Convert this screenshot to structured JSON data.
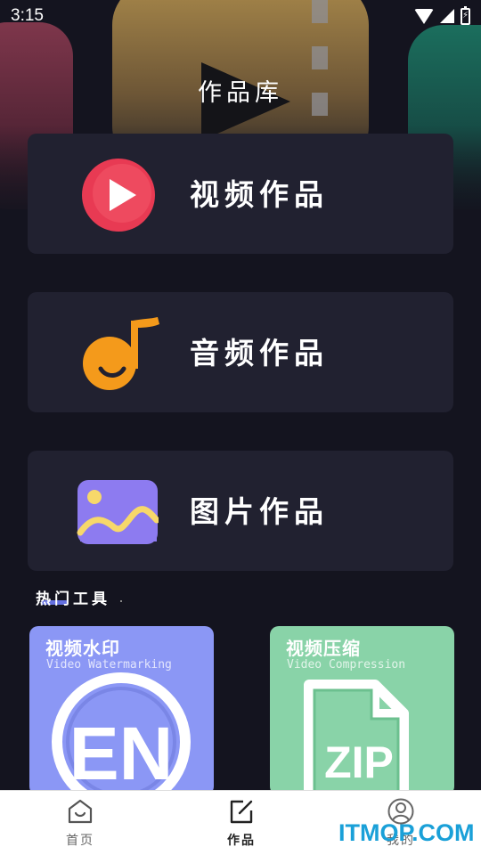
{
  "status_bar": {
    "time": "3:15",
    "battery_glyph": "⚡"
  },
  "header": {
    "title": "作品库"
  },
  "cards": [
    {
      "label": "视频作品",
      "icon": "video-play-icon",
      "color": "#e83a53"
    },
    {
      "label": "音频作品",
      "icon": "music-note-icon",
      "color": "#f49a1b"
    },
    {
      "label": "图片作品",
      "icon": "image-icon",
      "color": "#8d7bf0"
    }
  ],
  "hot_tools": {
    "title": "热门工具",
    "items": [
      {
        "title": "视频水印",
        "subtitle": "Video Watermarking",
        "art_text": "EN",
        "color": "#8b97f5"
      },
      {
        "title": "视频压缩",
        "subtitle": "Video Compression",
        "art_text": "ZIP",
        "color": "#89d3a8"
      }
    ]
  },
  "bottom_nav": [
    {
      "label": "首页",
      "icon": "home-smile-icon"
    },
    {
      "label": "作品",
      "icon": "edit-icon",
      "active": true
    },
    {
      "label": "我的",
      "icon": "user-icon"
    }
  ],
  "watermark": "ITMOP.COM"
}
